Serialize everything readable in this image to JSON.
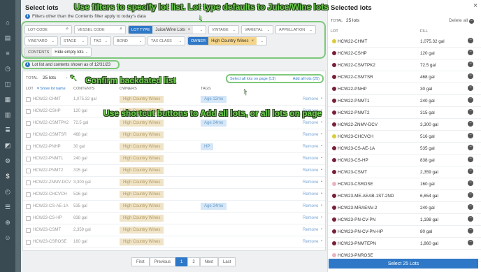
{
  "sidebar": {
    "icons": [
      "home-icon",
      "briefcase-icon",
      "list-icon",
      "clock-icon",
      "dashboard-icon",
      "grid-icon",
      "table-icon",
      "stack-icon",
      "chart-icon",
      "gear-icon",
      "dollar-icon",
      "clock-icon",
      "layers-icon",
      "code-icon",
      "user-icon"
    ],
    "icon_chars": [
      "⌂",
      "▤",
      "≡",
      "◷",
      "◫",
      "▦",
      "▥",
      "≣",
      "◩",
      "⚙",
      "$",
      "◴",
      "☰",
      "⊕",
      "☺"
    ]
  },
  "select_lots": {
    "title": "Select lots",
    "info_text": "Filters other than the Contents filter apply to today's data",
    "filters": {
      "lot_code_placeholder": "LOT CODE",
      "vessel_code_placeholder": "VESSEL CODE",
      "lot_type_label": "LOT TYPE",
      "lot_type_value": "Juice/Wine Lots",
      "vintage": "VINTAGE",
      "varietal": "VARIETAL",
      "appellation": "APPELLATION",
      "vineyard": "VINEYARD",
      "stage": "STAGE",
      "tag": "TAG",
      "bond": "BOND",
      "tax_class": "TAX CLASS",
      "owner_label": "OWNER",
      "owner_value": "High Country Wines",
      "contents_label": "CONTENTS",
      "contents_value": "Hide empty lots"
    },
    "date_info": "Lot list and contents shown as of 12/31/23",
    "total_label": "TOTAL",
    "total_value": "25 lots",
    "select_all_page": "Select all lots on page (13)",
    "add_all": "Add all lots (25)",
    "columns": {
      "lot": "LOT",
      "show_lot_name": "Show lot name",
      "contents": "CONTENTS",
      "owners": "OWNERS",
      "tags": "TAGS"
    },
    "rows": [
      {
        "lot": "HCW22-CHMT",
        "contents": "1,075.32 gal",
        "owner": "High Country Wines",
        "tag": "Age 12mo"
      },
      {
        "lot": "HCW22-CSHP",
        "contents": "120 gal",
        "owner": "High Country Wines",
        "tag": ""
      },
      {
        "lot": "HCW22-CSMTPK2",
        "contents": "72.5 gal",
        "owner": "High Country Wines",
        "tag": "Age 24mo"
      },
      {
        "lot": "HCW22-CSMTSR",
        "contents": "468 gal",
        "owner": "High Country Wines",
        "tag": ""
      },
      {
        "lot": "HCW22-PNHP",
        "contents": "30 gal",
        "owner": "High Country Wines",
        "tag": "HP"
      },
      {
        "lot": "HCW22-PNMT1",
        "contents": "240 gal",
        "owner": "High Country Wines",
        "tag": ""
      },
      {
        "lot": "HCW22-PNMT2",
        "contents": "315 gal",
        "owner": "High Country Wines",
        "tag": ""
      },
      {
        "lot": "HCW22-ZNMV-DCV",
        "contents": "3,300 gal",
        "owner": "High Country Wines",
        "tag": ""
      },
      {
        "lot": "HCW23-CHCVCH",
        "contents": "516 gal",
        "owner": "High Country Wines",
        "tag": ""
      },
      {
        "lot": "HCW23-CS-AE-1A",
        "contents": "535 gal",
        "owner": "High Country Wines",
        "tag": "Age 24mo"
      },
      {
        "lot": "HCW23-CS-HP",
        "contents": "838 gal",
        "owner": "High Country Wines",
        "tag": ""
      },
      {
        "lot": "HCW23-CSMT",
        "contents": "2,359 gal",
        "owner": "High Country Wines",
        "tag": ""
      },
      {
        "lot": "HCW23-CSROSE",
        "contents": "160 gal",
        "owner": "High Country Wines",
        "tag": ""
      }
    ],
    "remove_label": "Remove",
    "pagination": {
      "first": "First",
      "previous": "Previous",
      "page1": "1",
      "page2": "2",
      "next": "Next",
      "last": "Last"
    }
  },
  "selected_lots": {
    "title": "Selected lots",
    "total_label": "TOTAL",
    "total_value": "25 lots",
    "delete_all": "Delete all",
    "col_lot": "LOT",
    "col_fill": "FILL",
    "items": [
      {
        "lot": "HCW22-CHMT",
        "fill": "1,075.32 gal",
        "color": "#d8cc3a"
      },
      {
        "lot": "HCW22-CSHP",
        "fill": "120 gal",
        "color": "#7a1f3a"
      },
      {
        "lot": "HCW22-CSMTPK2",
        "fill": "72.5 gal",
        "color": "#7a1f3a"
      },
      {
        "lot": "HCW22-CSMTSR",
        "fill": "468 gal",
        "color": "#7a1f3a"
      },
      {
        "lot": "HCW22-PNHP",
        "fill": "30 gal",
        "color": "#7a1f3a"
      },
      {
        "lot": "HCW22-PNMT1",
        "fill": "240 gal",
        "color": "#7a1f3a"
      },
      {
        "lot": "HCW22-PNMT2",
        "fill": "315 gal",
        "color": "#7a1f3a"
      },
      {
        "lot": "HCW22-ZNMV-DCV",
        "fill": "3,300 gal",
        "color": "#7a1f3a"
      },
      {
        "lot": "HCW23-CHCVCH",
        "fill": "516 gal",
        "color": "#d8cc3a"
      },
      {
        "lot": "HCW23-CS-AE-1A",
        "fill": "535 gal",
        "color": "#7a1f3a"
      },
      {
        "lot": "HCW23-CS-HP",
        "fill": "838 gal",
        "color": "#7a1f3a"
      },
      {
        "lot": "HCW23-CSMT",
        "fill": "2,359 gal",
        "color": "#7a1f3a"
      },
      {
        "lot": "HCW23-CSROSE",
        "fill": "160 gal",
        "color": "#e8b4c0"
      },
      {
        "lot": "HCW23-ME-AEAB-1ST-2ND",
        "fill": "6,654 gal",
        "color": "#7a1f3a"
      },
      {
        "lot": "HCW23-MRAENV-2",
        "fill": "240 gal",
        "color": "#7a1f3a"
      },
      {
        "lot": "HCW23-PN-CV-PN",
        "fill": "1,198 gal",
        "color": "#7a1f3a"
      },
      {
        "lot": "HCW23-PN-CV-PN-HP",
        "fill": "80 gal",
        "color": "#7a1f3a"
      },
      {
        "lot": "HCW23-PNMTEPN",
        "fill": "1,860 gal",
        "color": "#7a1f3a"
      },
      {
        "lot": "HCW23-PNROSE",
        "fill": "",
        "color": "#e8b4c0"
      }
    ],
    "select_button": "Select 25 Lots"
  },
  "annotations": {
    "filters": "Use filters to specify lot list. Lot type defaults to Juice/Wine lots",
    "backdated": "Confirm backdated list",
    "shortcut": "Use shortcut buttons to Add all lots, or all lots on page"
  }
}
